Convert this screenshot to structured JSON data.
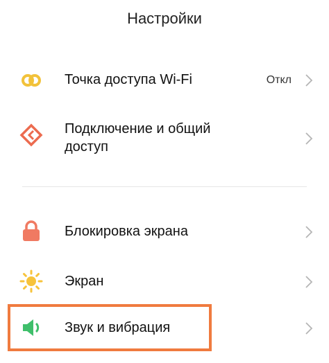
{
  "header": {
    "title": "Настройки"
  },
  "items": [
    {
      "label": "Точка доступа Wi-Fi",
      "value": "Откл",
      "icon": "hotspot-icon"
    },
    {
      "label_line1": "Подключение и общий",
      "label_line2": "доступ",
      "icon": "connection-sharing-icon"
    },
    {
      "label": "Блокировка экрана",
      "icon": "lock-icon"
    },
    {
      "label": "Экран",
      "icon": "brightness-icon"
    },
    {
      "label": "Звук и вибрация",
      "icon": "sound-icon"
    }
  ],
  "colors": {
    "hotspot": "#f2c23a",
    "connection": "#ec6b4f",
    "lock": "#f07a62",
    "brightness": "#f7c33b",
    "sound": "#3fbf6b",
    "highlight": "#f07b3f"
  }
}
